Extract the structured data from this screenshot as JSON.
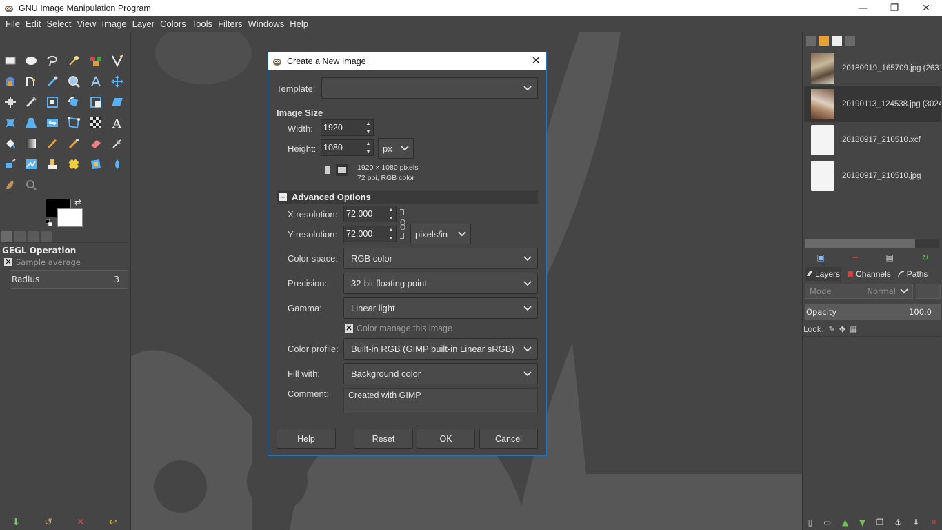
{
  "window": {
    "title": "GNU Image Manipulation Program",
    "controls": {
      "minimize": "—",
      "restore": "❐",
      "close": "✕"
    }
  },
  "menubar": [
    "File",
    "Edit",
    "Select",
    "View",
    "Image",
    "Layer",
    "Colors",
    "Tools",
    "Filters",
    "Windows",
    "Help"
  ],
  "tool_options": {
    "title": "GEGL Operation",
    "sample_average_label": "Sample average",
    "radius_label": "Radius",
    "radius_value": "3"
  },
  "images_panel": {
    "items": [
      {
        "name": "20180919_165709.jpg (2631",
        "thumb": "photo"
      },
      {
        "name": "20190113_124538.jpg (3024",
        "thumb": "photo",
        "selected": true
      },
      {
        "name": "20180917_210510.xcf",
        "thumb": "blank"
      },
      {
        "name": "20180917_210510.jpg",
        "thumb": "blank"
      }
    ]
  },
  "layers_panel": {
    "tabs": [
      "Layers",
      "Channels",
      "Paths"
    ],
    "mode_label": "Mode",
    "mode_value": "Normal",
    "opacity_label": "Opacity",
    "opacity_value": "100.0",
    "lock_label": "Lock:"
  },
  "dialog": {
    "title": "Create a New Image",
    "close": "✕",
    "template_label": "Template:",
    "template_value": "",
    "image_size_title": "Image Size",
    "width_label": "Width:",
    "width_value": "1920",
    "height_label": "Height:",
    "height_value": "1080",
    "unit_value": "px",
    "size_info_line1": "1920 × 1080 pixels",
    "size_info_line2": "72 ppi, RGB color",
    "advanced_title": "Advanced Options",
    "xres_label": "X resolution:",
    "xres_value": "72.000",
    "yres_label": "Y resolution:",
    "yres_value": "72.000",
    "res_unit_value": "pixels/in",
    "color_space_label": "Color space:",
    "color_space_value": "RGB color",
    "precision_label": "Precision:",
    "precision_value": "32-bit floating point",
    "gamma_label": "Gamma:",
    "gamma_value": "Linear light",
    "color_manage_label": "Color manage this image",
    "color_profile_label": "Color profile:",
    "color_profile_value": "Built-in RGB (GIMP built-in Linear sRGB)",
    "fill_label": "Fill with:",
    "fill_value": "Background color",
    "comment_label": "Comment:",
    "comment_value": "Created with GIMP",
    "buttons": {
      "help": "Help",
      "reset": "Reset",
      "ok": "OK",
      "cancel": "Cancel"
    }
  },
  "colors": {
    "accent": "#2b73b8",
    "background": "#454545",
    "foreground_color": "#000000",
    "background_color": "#ffffff"
  }
}
